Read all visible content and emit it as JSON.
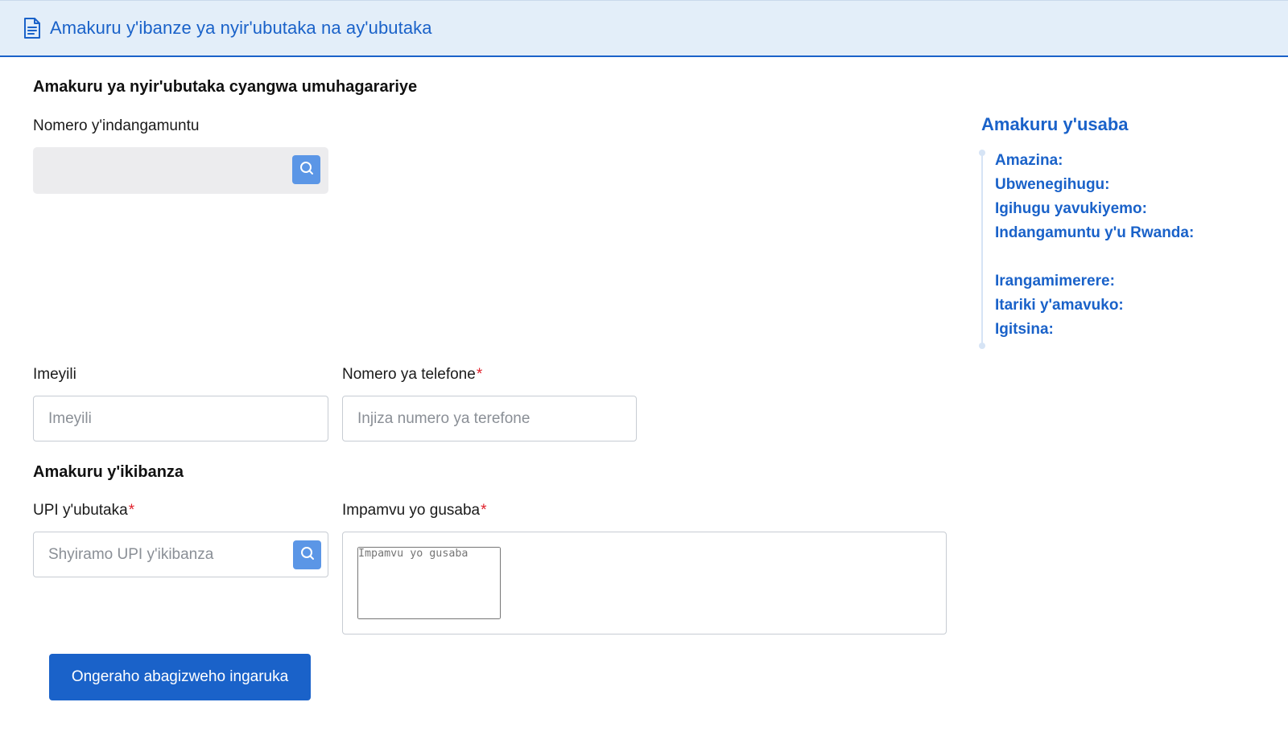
{
  "header": {
    "title": "Amakuru y'ibanze ya nyir'ubutaka na ay'ubutaka"
  },
  "owner_section": {
    "title": "Amakuru ya nyir'ubutaka cyangwa umuhagarariye",
    "id_label": "Nomero y'indangamuntu",
    "id_value": ""
  },
  "contact": {
    "email_label": "Imeyili",
    "email_placeholder": "Imeyili",
    "phone_label": "Nomero ya telefone",
    "phone_placeholder": "Injiza numero ya terefone",
    "required_mark": "*"
  },
  "plot_section": {
    "title": "Amakuru y'ikibanza",
    "upi_label": "UPI y'ubutaka",
    "upi_placeholder": "Shyiramo UPI y'ikibanza",
    "reason_label": "Impamvu yo gusaba",
    "reason_placeholder": "Impamvu yo gusaba"
  },
  "actions": {
    "add_heirs_label": "Ongeraho abagizweho ingaruka"
  },
  "applicant_panel": {
    "title": "Amakuru y'usaba",
    "fields": [
      "Amazina:",
      "Ubwenegihugu:",
      "Igihugu yavukiyemo:",
      "Indangamuntu y'u Rwanda:",
      "Irangamimerere:",
      "Itariki y'amavuko:",
      "Igitsina:"
    ]
  },
  "colors": {
    "primary": "#1a62c9",
    "header_bg": "#e3eef9",
    "search_button": "#5b96e6",
    "required": "#e0202b"
  },
  "icons": {
    "header": "document-icon",
    "search": "search-icon"
  }
}
